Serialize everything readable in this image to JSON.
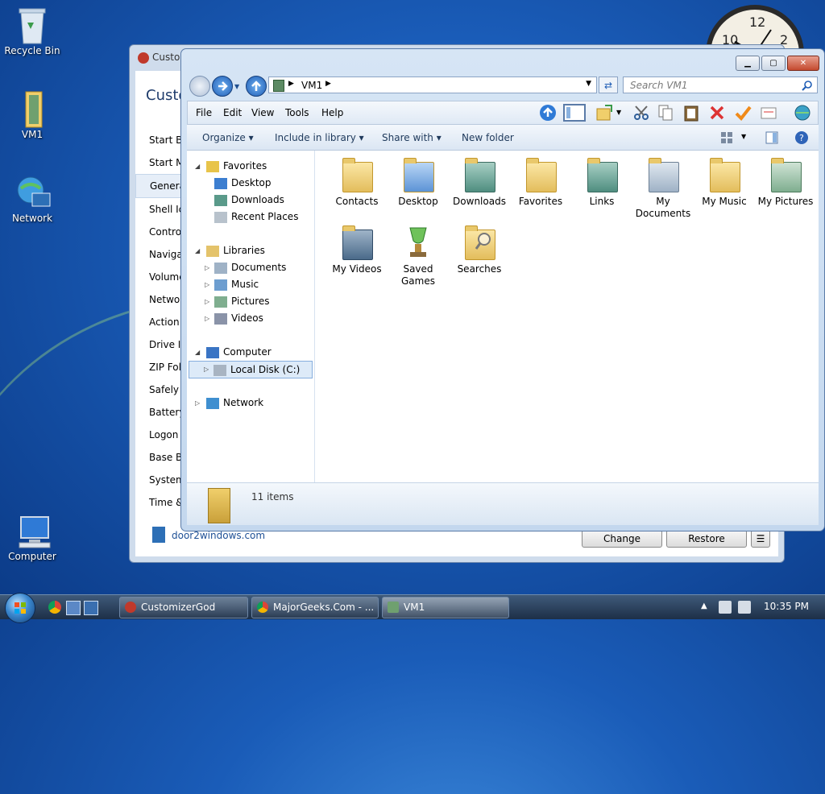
{
  "desktop": {
    "icons": [
      {
        "label": "Recycle Bin"
      },
      {
        "label": "VM1"
      },
      {
        "label": "Network"
      },
      {
        "label": "Computer"
      }
    ],
    "clock": {
      "n10": "10",
      "n12": "12",
      "n2": "2"
    }
  },
  "bg_window": {
    "title": "Custo",
    "heading": "Custo",
    "nav_items": [
      "Start Bu",
      "Start M",
      "General",
      "Shell Ico",
      "Control",
      "Navigat",
      "Volume",
      "Networ",
      "Action C",
      "Drive Ic",
      "ZIP Fold",
      "Safely R",
      "Battery",
      "Logon S",
      "Base Bra",
      "System",
      "Time &"
    ],
    "footer_link": "door2windows.com",
    "buttons": {
      "change": "Change",
      "restore": "Restore",
      "menu": "☰"
    }
  },
  "explorer": {
    "breadcrumb": "VM1",
    "search_placeholder": "Search VM1",
    "menu": [
      "File",
      "Edit",
      "View",
      "Tools",
      "Help"
    ],
    "commands": {
      "organize": "Organize",
      "include": "Include in library",
      "share": "Share with",
      "new_folder": "New folder"
    },
    "nav": {
      "favorites": "Favorites",
      "desktop": "Desktop",
      "downloads": "Downloads",
      "recent": "Recent Places",
      "libraries": "Libraries",
      "documents": "Documents",
      "music": "Music",
      "pictures": "Pictures",
      "videos": "Videos",
      "computer": "Computer",
      "local_disk": "Local Disk (C:)",
      "network": "Network"
    },
    "items": [
      {
        "label": "Contacts"
      },
      {
        "label": "Desktop"
      },
      {
        "label": "Downloads"
      },
      {
        "label": "Favorites"
      },
      {
        "label": "Links"
      },
      {
        "label": "My Documents"
      },
      {
        "label": "My Music"
      },
      {
        "label": "My Pictures"
      },
      {
        "label": "My Videos"
      },
      {
        "label": "Saved Games"
      },
      {
        "label": "Searches"
      }
    ],
    "status_count": "11 items"
  },
  "taskbar": {
    "buttons": [
      {
        "label": "CustomizerGod"
      },
      {
        "label": "MajorGeeks.Com - ..."
      },
      {
        "label": "VM1"
      }
    ],
    "time": "10:35 PM"
  }
}
